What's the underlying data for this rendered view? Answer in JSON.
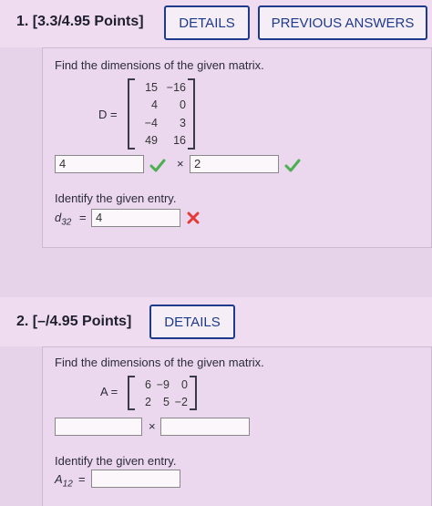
{
  "q1": {
    "header": "1.  [3.3/4.95 Points]",
    "details_label": "DETAILS",
    "prev_answers_label": "PREVIOUS ANSWERS",
    "prompt": "Find the dimensions of the given matrix.",
    "matrix_name": "D =",
    "matrix": [
      [
        "15",
        "−16"
      ],
      [
        "4",
        "0"
      ],
      [
        "−4",
        "3"
      ],
      [
        "49",
        "16"
      ]
    ],
    "dim_rows": "4",
    "dim_times": "×",
    "dim_cols": "2",
    "entry_prompt": "Identify the given entry.",
    "entry_var": "d",
    "entry_sub": "32",
    "entry_eq": "=",
    "entry_value": "4"
  },
  "q2": {
    "header": "2.  [–/4.95 Points]",
    "details_label": "DETAILS",
    "prompt": "Find the dimensions of the given matrix.",
    "matrix_name": "A =",
    "matrix": [
      [
        "6",
        "−9",
        "0"
      ],
      [
        "2",
        "5",
        "−2"
      ]
    ],
    "dim_times": "×",
    "entry_prompt": "Identify the given entry.",
    "entry_var": "A",
    "entry_sub": "12",
    "entry_eq": "="
  },
  "colors": {
    "correct": "#4caf50",
    "incorrect": "#e53935",
    "button_border": "#1e3a8a"
  },
  "icons": [
    "check-icon",
    "cross-icon"
  ]
}
